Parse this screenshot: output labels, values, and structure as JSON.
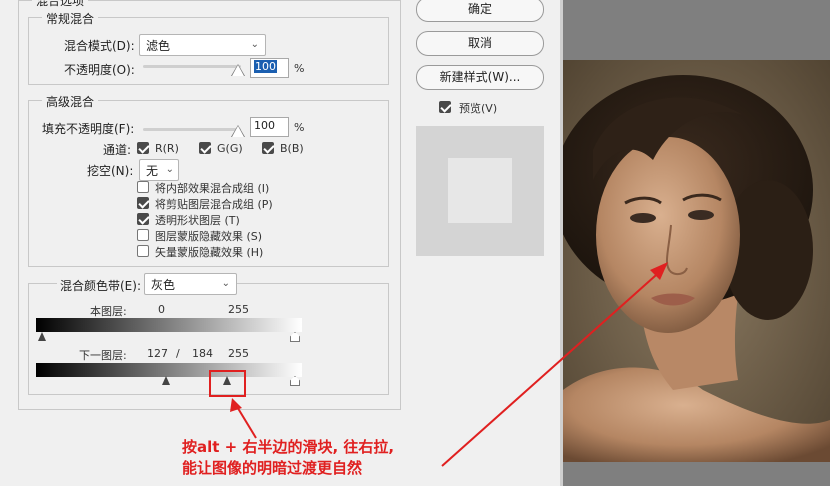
{
  "dialog": {
    "top_group_title": "混合选项",
    "general_blending": {
      "title": "常规混合",
      "blend_mode_label": "混合模式(D):",
      "blend_mode_value": "滤色",
      "opacity_label": "不透明度(O):",
      "opacity_value": "100",
      "opacity_unit": "%"
    },
    "advanced_blending": {
      "title": "高级混合",
      "fill_opacity_label": "填充不透明度(F):",
      "fill_opacity_value": "100",
      "fill_opacity_unit": "%",
      "channels_label": "通道:",
      "channels": [
        {
          "label": "R(R)",
          "checked": true
        },
        {
          "label": "G(G)",
          "checked": true
        },
        {
          "label": "B(B)",
          "checked": true
        }
      ],
      "knockout_label": "挖空(N):",
      "knockout_value": "无",
      "options": [
        {
          "label": "将内部效果混合成组 (I)",
          "checked": false
        },
        {
          "label": "将剪贴图层混合成组 (P)",
          "checked": true
        },
        {
          "label": "透明形状图层 (T)",
          "checked": true
        },
        {
          "label": "图层蒙版隐藏效果 (S)",
          "checked": false
        },
        {
          "label": "矢量蒙版隐藏效果 (H)",
          "checked": false
        }
      ]
    },
    "blend_if": {
      "label": "混合颜色带(E):",
      "value": "灰色",
      "this_layer_label": "本图层:",
      "this_layer_low": "0",
      "this_layer_high": "255",
      "underlying_label": "下一图层:",
      "underlying_low": "127",
      "underlying_sep": "/",
      "underlying_mid": "184",
      "underlying_high": "255"
    }
  },
  "buttons": {
    "ok": "确定",
    "cancel": "取消",
    "new_style": "新建样式(W)...",
    "preview_label": "预览(V)"
  },
  "annotation": {
    "line1": "按alt + 右半边的滑块, 往右拉,",
    "line2": "能让图像的明暗过渡更自然",
    "color": "#e02020"
  }
}
